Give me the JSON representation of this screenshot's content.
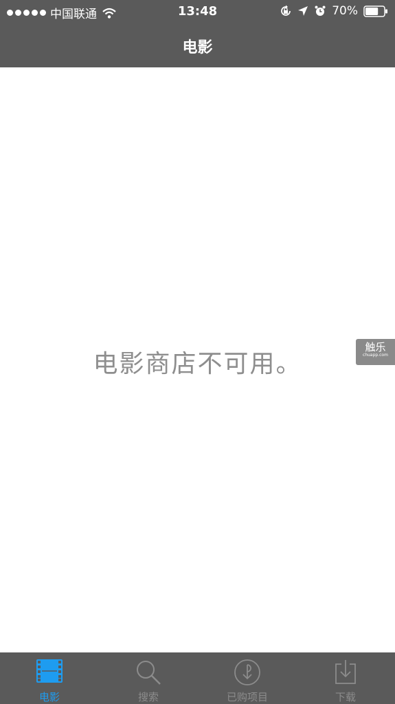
{
  "status_bar": {
    "carrier": "中国联通",
    "time": "13:48",
    "battery": "70%",
    "battery_level": 0.7
  },
  "nav": {
    "title": "电影"
  },
  "content": {
    "message": "电影商店不可用。"
  },
  "watermark": {
    "main": "触乐",
    "sub": "chuapp.com"
  },
  "tabs": [
    {
      "label": "电影",
      "icon": "film-icon",
      "active": true
    },
    {
      "label": "搜索",
      "icon": "search-icon",
      "active": false
    },
    {
      "label": "已购项目",
      "icon": "purchased-icon",
      "active": false
    },
    {
      "label": "下载",
      "icon": "download-icon",
      "active": false
    }
  ],
  "colors": {
    "bar_bg": "#5a5a5a",
    "active_tint": "#1e9cf0",
    "inactive_tint": "#8c8c8c",
    "message_text": "#8e8e8e"
  }
}
